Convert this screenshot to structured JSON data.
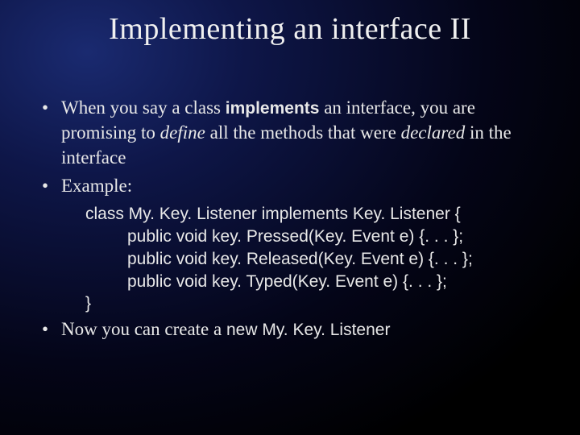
{
  "title": "Implementing an interface II",
  "bullet1": {
    "p1": "When you say a class ",
    "kw_implements": "implements",
    "p2": " an interface, you are promising to ",
    "kw_define": "define",
    "p3": " all the methods that were ",
    "kw_declared": "declared",
    "p4": " in the interface"
  },
  "bullet2": "Example:",
  "code": {
    "l1a": "class My. Key. Listener ",
    "l1b": "implements",
    "l1c": " Key. Listener {",
    "l2": "public void key. Pressed(Key. Event e) {. . . };",
    "l3": "public void key. Released(Key. Event e) {. . . };",
    "l4": "public void key. Typed(Key. Event e) {. . . };",
    "l5": "}"
  },
  "bullet3": {
    "p1": "Now you can create a ",
    "kw_new": "new My. Key. Listener"
  }
}
